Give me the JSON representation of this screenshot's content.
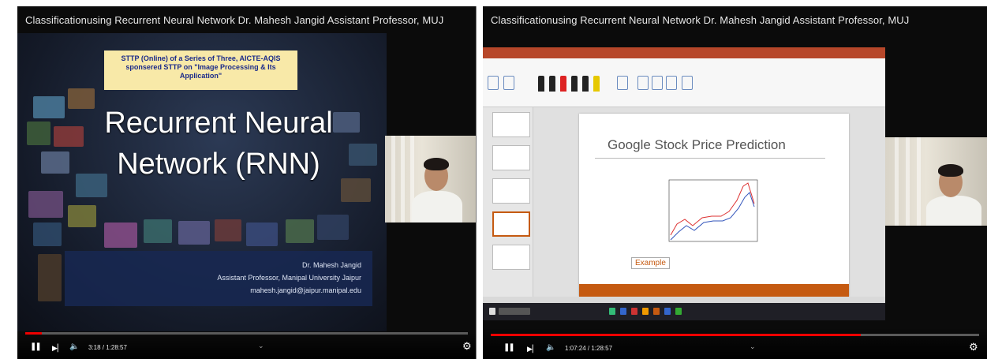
{
  "left_video": {
    "title": "Classificationusing Recurrent Neural Network Dr. Mahesh Jangid Assistant Professor, MUJ",
    "slide": {
      "banner": "STTP (Online) of a Series of Three, AICTE-AQIS sponsered STTP on \"Image Processing & Its Application\"",
      "heading_line1": "Recurrent Neural",
      "heading_line2": "Network (RNN)",
      "author_name": "Dr. Mahesh Jangid",
      "author_role": "Assistant Professor, Manipal University Jaipur",
      "author_email": "mahesh.jangid@jaipur.manipal.edu"
    },
    "controls": {
      "time": "3:18 / 1:28:57",
      "progress_fraction": 0.037,
      "progress_color": "#ee0000"
    }
  },
  "right_video": {
    "title": "Classificationusing Recurrent Neural Network Dr. Mahesh Jangid Assistant Professor, MUJ",
    "slide": {
      "heading": "Google Stock Price Prediction",
      "example_label": "Example",
      "accent_color": "#c55a11"
    },
    "controls": {
      "time": "1:07:24 / 1:28:57",
      "progress_fraction": 0.758,
      "progress_color": "#ee0000"
    }
  },
  "icons": {
    "pause": "❚❚",
    "next": "▶▏",
    "volume": "🔈",
    "settings": "⚙",
    "chevron": "⌄"
  }
}
